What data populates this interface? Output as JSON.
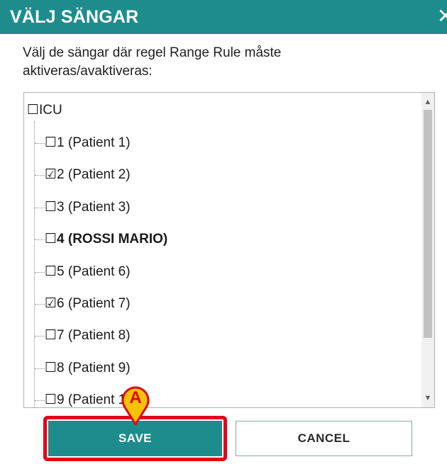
{
  "dialog": {
    "title": "VÄLJ SÄNGAR",
    "close_glyph": "✕",
    "instruction": "Välj de sängar där regel Range Rule måste aktiveras/avaktiveras:"
  },
  "tree": {
    "root": {
      "label": "☐ICU",
      "checked": false
    },
    "items": [
      {
        "label": "☐1 (Patient 1)",
        "checked": false,
        "bold": false
      },
      {
        "label": "☑2 (Patient 2)",
        "checked": true,
        "bold": false
      },
      {
        "label": "☐3 (Patient 3)",
        "checked": false,
        "bold": false
      },
      {
        "label": "☐4 (ROSSI MARIO)",
        "checked": false,
        "bold": true
      },
      {
        "label": "☐5 (Patient 6)",
        "checked": false,
        "bold": false
      },
      {
        "label": "☑6 (Patient 7)",
        "checked": true,
        "bold": false
      },
      {
        "label": "☐7 (Patient 8)",
        "checked": false,
        "bold": false
      },
      {
        "label": "☐8 (Patient 9)",
        "checked": false,
        "bold": false
      },
      {
        "label": "☐9 (Patient 10)",
        "checked": false,
        "bold": false
      }
    ]
  },
  "scrollbar": {
    "up_glyph": "▲",
    "down_glyph": "▼"
  },
  "buttons": {
    "save": "SAVE",
    "cancel": "CANCEL"
  },
  "annotation": {
    "marker_label": "A",
    "highlight_color": "#e3001b",
    "marker_fill": "#f5c400"
  },
  "colors": {
    "accent": "#1e8c8c"
  },
  "icons": {
    "close": "close-icon",
    "checkbox_unchecked": "checkbox-unchecked-icon",
    "checkbox_checked": "checkbox-checked-icon",
    "marker": "map-pin-icon"
  }
}
